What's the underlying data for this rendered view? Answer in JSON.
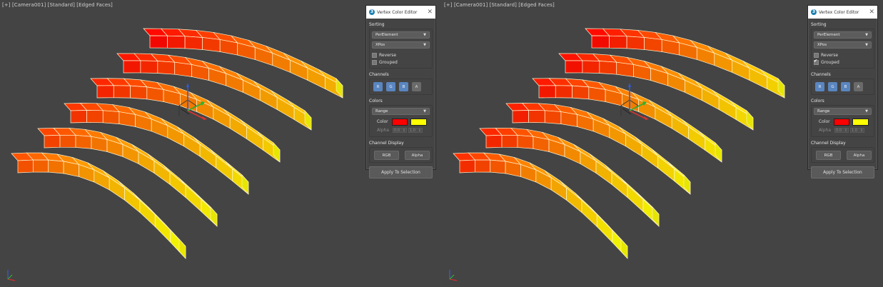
{
  "viewports": [
    {
      "label": "[+] [Camera001] [Standard] [Edged Faces]",
      "grouped_gradient": false,
      "panel": {
        "title": "Vertex Color Editor",
        "sorting_label": "Sorting",
        "sort_mode": "PerElement",
        "sort_axis": "XPos",
        "reverse_label": "Reverse",
        "reverse_checked": false,
        "grouped_label": "Grouped",
        "grouped_checked": false,
        "channels_label": "Channels",
        "channels": [
          "R",
          "G",
          "B",
          "A"
        ],
        "colors_label": "Colors",
        "color_mode": "Range",
        "color_label": "Color",
        "color_start": "#ff0000",
        "color_end": "#ffff00",
        "alpha_label": "Alpha",
        "alpha_start": "0.0",
        "alpha_end": "1.0",
        "display_label": "Channel Display",
        "display_rgb": "RGB",
        "display_alpha": "Alpha",
        "apply_label": "Apply To Selection"
      }
    },
    {
      "label": "[+] [Camera001] [Standard] [Edged Faces]",
      "grouped_gradient": true,
      "panel": {
        "title": "Vertex Color Editor",
        "sorting_label": "Sorting",
        "sort_mode": "PerElement",
        "sort_axis": "XPos",
        "reverse_label": "Reverse",
        "reverse_checked": false,
        "grouped_label": "Grouped",
        "grouped_checked": true,
        "channels_label": "Channels",
        "channels": [
          "R",
          "G",
          "B",
          "A"
        ],
        "colors_label": "Colors",
        "color_mode": "Range",
        "color_label": "Color",
        "color_start": "#ff0000",
        "color_end": "#ffff00",
        "alpha_label": "Alpha",
        "alpha_start": "0.0",
        "alpha_end": "1.0",
        "display_label": "Channel Display",
        "display_rgb": "RGB",
        "display_alpha": "Alpha",
        "apply_label": "Apply To Selection"
      }
    }
  ],
  "icons": {
    "close": "close-icon",
    "logo": "max-logo-icon",
    "dropdown": "chevron-down-icon"
  }
}
